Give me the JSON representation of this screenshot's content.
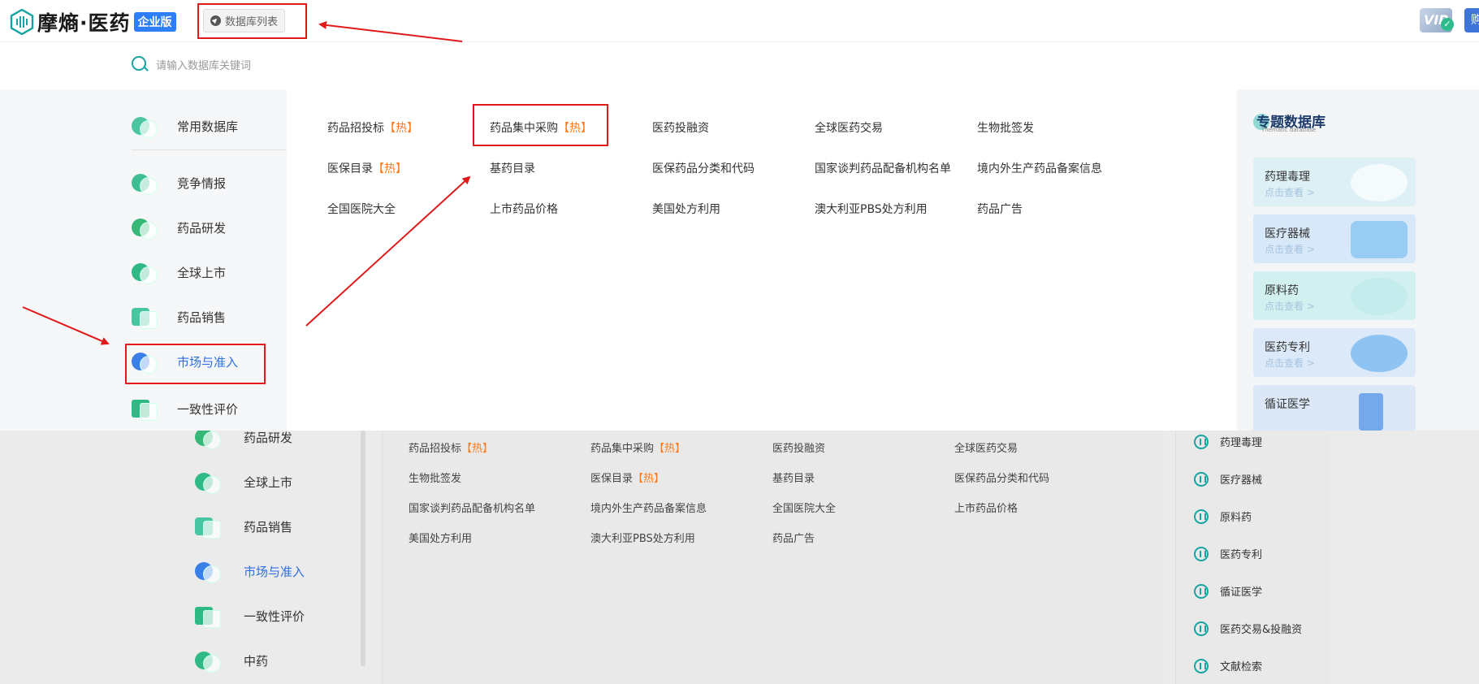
{
  "header": {
    "logo_text": "摩熵·医药",
    "edition_badge": "企业版",
    "db_list_label": "数据库列表",
    "vip_label": "VIP",
    "avatar_text": "购"
  },
  "search": {
    "placeholder": "请输入数据库关键词"
  },
  "categories": [
    {
      "label": "常用数据库",
      "color": "#4cc6a0"
    },
    {
      "label": "竞争情报",
      "color": "#3fbf91"
    },
    {
      "label": "药品研发",
      "color": "#38b877"
    },
    {
      "label": "全球上市",
      "color": "#2fb985"
    },
    {
      "label": "药品销售",
      "color": "#48c5a1"
    },
    {
      "label": "市场与准入",
      "color": "#3a7fe8"
    },
    {
      "label": "一致性评价",
      "color": "#2fb985"
    }
  ],
  "links": [
    {
      "text": "药品招投标",
      "hot": "【热】"
    },
    {
      "text": "药品集中采购",
      "hot": "【热】"
    },
    {
      "text": "医药投融资",
      "hot": ""
    },
    {
      "text": "全球医药交易",
      "hot": ""
    },
    {
      "text": "生物批签发",
      "hot": ""
    },
    {
      "text": "医保目录",
      "hot": "【热】"
    },
    {
      "text": "基药目录",
      "hot": ""
    },
    {
      "text": "医保药品分类和代码",
      "hot": ""
    },
    {
      "text": "国家谈判药品配备机构名单",
      "hot": ""
    },
    {
      "text": "境内外生产药品备案信息",
      "hot": ""
    },
    {
      "text": "全国医院大全",
      "hot": ""
    },
    {
      "text": "上市药品价格",
      "hot": ""
    },
    {
      "text": "美国处方利用",
      "hot": ""
    },
    {
      "text": "澳大利亚PBS处方利用",
      "hot": ""
    },
    {
      "text": "药品广告",
      "hot": ""
    }
  ],
  "topics": {
    "title": "专题数据库",
    "subtitle": "Thematic database",
    "cta": "点击查看 >",
    "cards": [
      {
        "label": "药理毒理",
        "color": "#d9eef6"
      },
      {
        "label": "医疗器械",
        "color": "#d6e8f7"
      },
      {
        "label": "原料药",
        "color": "#d3f0ef"
      },
      {
        "label": "医药专利",
        "color": "#dbe9f8"
      },
      {
        "label": "循证医学",
        "color": "#dce8f7"
      }
    ]
  },
  "background": {
    "categories": [
      {
        "label": "药品研发"
      },
      {
        "label": "全球上市"
      },
      {
        "label": "药品销售"
      },
      {
        "label": "市场与准入"
      },
      {
        "label": "一致性评价"
      },
      {
        "label": "中药"
      }
    ],
    "links": [
      {
        "text": "药品招投标",
        "hot": "【热】"
      },
      {
        "text": "药品集中采购",
        "hot": "【热】"
      },
      {
        "text": "医药投融资",
        "hot": ""
      },
      {
        "text": "全球医药交易",
        "hot": ""
      },
      {
        "text": "生物批签发",
        "hot": ""
      },
      {
        "text": "医保目录",
        "hot": "【热】"
      },
      {
        "text": "基药目录",
        "hot": ""
      },
      {
        "text": "医保药品分类和代码",
        "hot": ""
      },
      {
        "text": "国家谈判药品配备机构名单",
        "hot": ""
      },
      {
        "text": "境内外生产药品备案信息",
        "hot": ""
      },
      {
        "text": "全国医院大全",
        "hot": ""
      },
      {
        "text": "上市药品价格",
        "hot": ""
      },
      {
        "text": "美国处方利用",
        "hot": ""
      },
      {
        "text": "澳大利亚PBS处方利用",
        "hot": ""
      },
      {
        "text": "药品广告",
        "hot": ""
      }
    ],
    "topics": [
      "药理毒理",
      "医疗器械",
      "原料药",
      "医药专利",
      "循证医学",
      "医药交易&投融资",
      "文献检索"
    ]
  },
  "colors": {
    "accent": "#2d6fe0",
    "hot": "#ff7a1a",
    "annotation": "#e01a1a",
    "teal": "#18a3a3"
  }
}
